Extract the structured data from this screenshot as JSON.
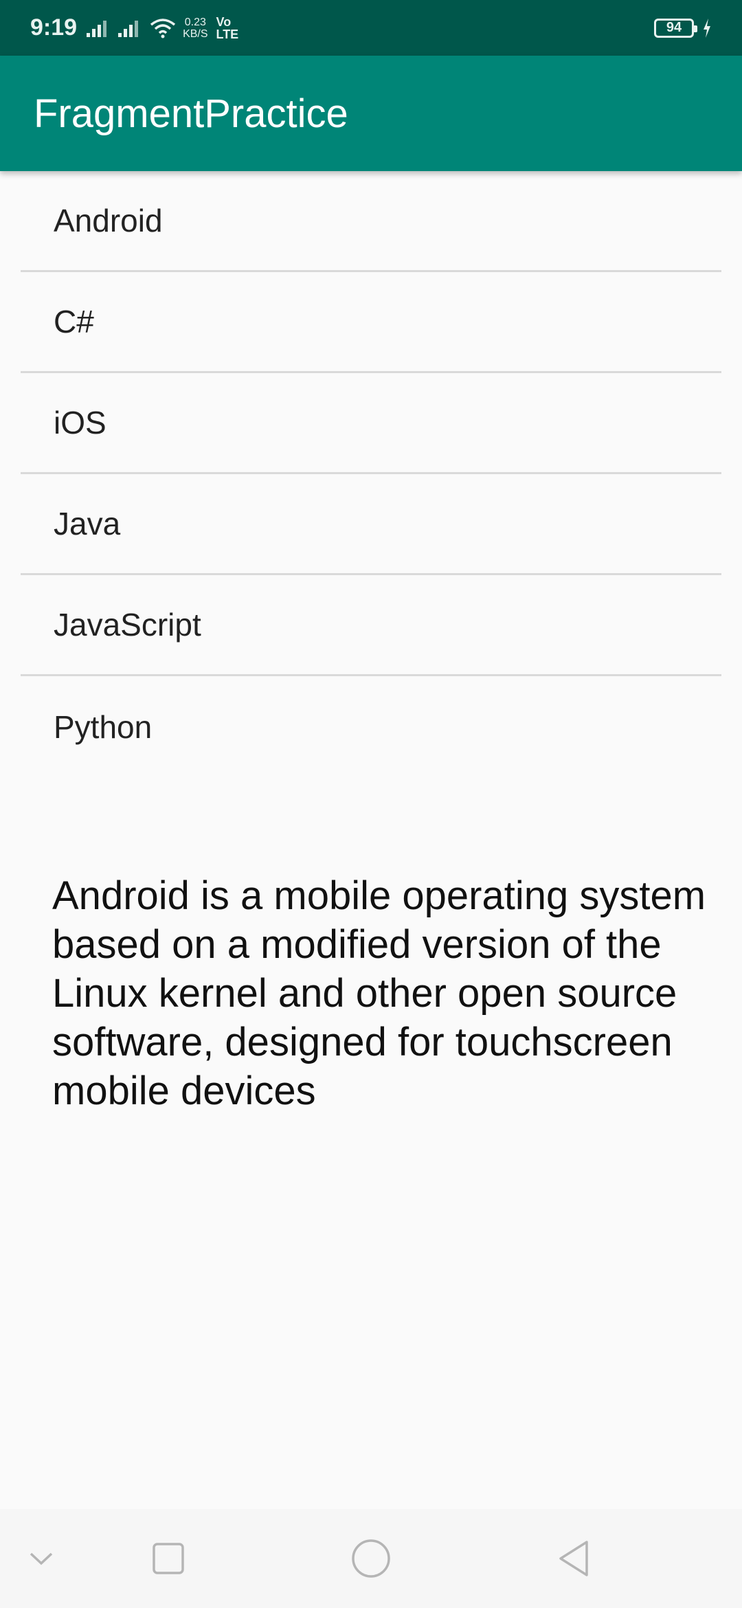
{
  "status_bar": {
    "time": "9:19",
    "net_speed_value": "0.23",
    "net_speed_unit": "KB/S",
    "vo": "Vo",
    "lte": "LTE",
    "battery": "94"
  },
  "app_bar": {
    "title": "FragmentPractice"
  },
  "list": {
    "items": [
      {
        "label": "Android"
      },
      {
        "label": "C#"
      },
      {
        "label": "iOS"
      },
      {
        "label": "Java"
      },
      {
        "label": "JavaScript"
      },
      {
        "label": "Python"
      }
    ]
  },
  "detail": {
    "text": "Android is a mobile operating system based on a modified version of the Linux kernel and other open source software, designed for touchscreen mobile devices"
  },
  "colors": {
    "status_bar": "#00574b",
    "app_bar": "#008577",
    "background": "#fafafa"
  },
  "nav_bar": {
    "icons": [
      "chevron-down-icon",
      "recents-square-icon",
      "home-circle-icon",
      "back-triangle-icon"
    ]
  }
}
